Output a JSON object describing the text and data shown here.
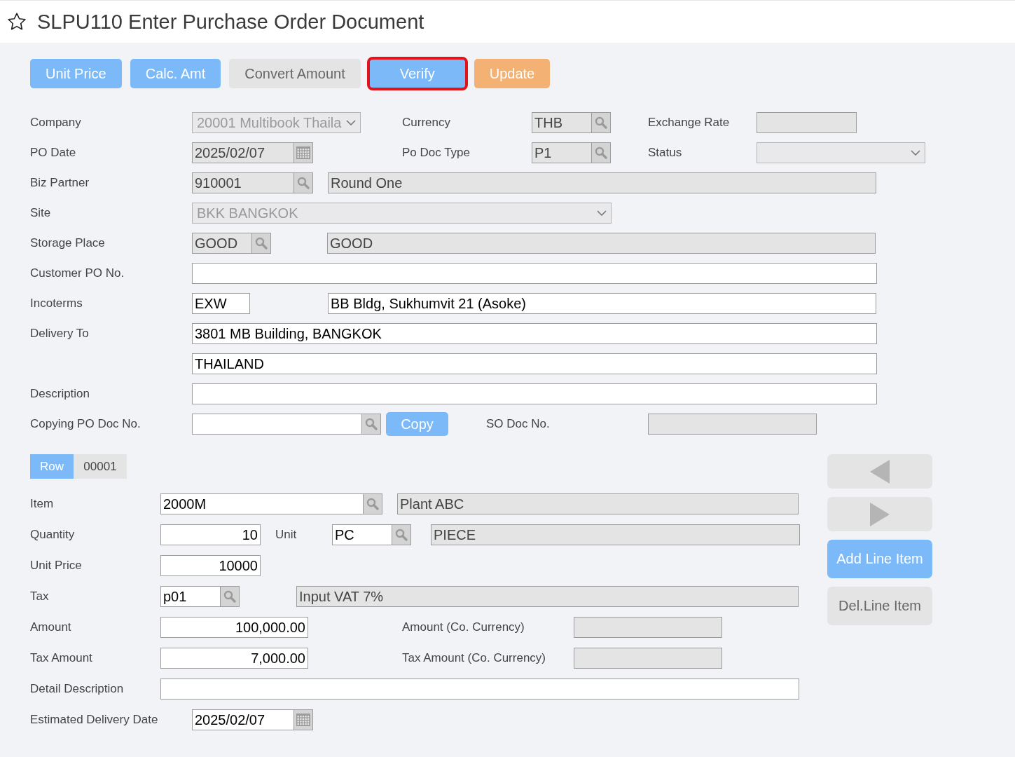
{
  "page": {
    "title": "SLPU110 Enter Purchase Order Document",
    "favorite": false
  },
  "toolbar": [
    {
      "label": "Unit Price",
      "kind": "primary",
      "highlighted": false
    },
    {
      "label": "Calc. Amt",
      "kind": "primary",
      "highlighted": false
    },
    {
      "label": "Convert Amount",
      "kind": "neutral",
      "highlighted": false
    },
    {
      "label": "Verify",
      "kind": "primary",
      "highlighted": true
    },
    {
      "label": "Update",
      "kind": "warning",
      "highlighted": false
    }
  ],
  "header": {
    "company": {
      "label": "Company",
      "value": "20001 Multibook Thaila",
      "editable": false,
      "kind": "select"
    },
    "currency": {
      "label": "Currency",
      "value": "THB",
      "editable": false,
      "kind": "lookup"
    },
    "exchange_rate": {
      "label": "Exchange Rate",
      "editable": false,
      "kind": "text"
    },
    "po_date": {
      "label": "PO Date",
      "value": "2025/02/07",
      "editable": false,
      "kind": "date"
    },
    "po_doc_type": {
      "label": "Po Doc Type",
      "value": "P1",
      "editable": false,
      "kind": "lookup"
    },
    "status": {
      "label": "Status",
      "editable": false,
      "kind": "select"
    },
    "biz_partner": {
      "label": "Biz Partner",
      "value": "910001",
      "editable": false,
      "kind": "lookup"
    },
    "biz_partner_name": {
      "value": "Round One",
      "editable": false,
      "kind": "text"
    },
    "site": {
      "label": "Site",
      "value": "BKK BANGKOK",
      "editable": false,
      "kind": "select"
    },
    "storage_place": {
      "label": "Storage Place",
      "value": "GOOD",
      "editable": false,
      "kind": "lookup"
    },
    "storage_place_name": {
      "value": "GOOD",
      "editable": false,
      "kind": "text"
    },
    "customer_po_no": {
      "label": "Customer PO No.",
      "editable": true,
      "kind": "text"
    },
    "incoterms": {
      "label": "Incoterms",
      "value": "EXW",
      "editable": true,
      "kind": "text"
    },
    "incoterms_name": {
      "value": "BB Bldg, Sukhumvit 21 (Asoke)",
      "editable": true,
      "kind": "text"
    },
    "delivery_to": {
      "label": "Delivery To",
      "value": "3801 MB Building, BANGKOK",
      "editable": true,
      "kind": "text"
    },
    "delivery_to_line_2": {
      "value": "THAILAND",
      "editable": true,
      "kind": "text"
    },
    "description": {
      "label": "Description",
      "editable": true,
      "kind": "text"
    },
    "copying_po_doc_no": {
      "label": "Copying PO Doc No.",
      "editable": true,
      "kind": "lookup"
    },
    "copy_button": "Copy",
    "so_doc_no": {
      "label": "SO Doc No.",
      "editable": false,
      "kind": "text"
    }
  },
  "row_tab": {
    "label": "Row",
    "number": "00001"
  },
  "line": {
    "item": {
      "label": "Item",
      "value": "2000M",
      "editable": true,
      "kind": "lookup"
    },
    "item_name": {
      "value": "Plant ABC",
      "editable": false,
      "kind": "text"
    },
    "quantity": {
      "label": "Quantity",
      "value": "10",
      "editable": true,
      "kind": "number"
    },
    "unit": {
      "label": "Unit",
      "value": "PC",
      "editable": true,
      "kind": "lookup"
    },
    "unit_name": {
      "value": "PIECE",
      "editable": false,
      "kind": "text"
    },
    "unit_price": {
      "label": "Unit Price",
      "value": "10000",
      "editable": true,
      "kind": "number"
    },
    "tax": {
      "label": "Tax",
      "value": "p01",
      "editable": true,
      "kind": "lookup"
    },
    "tax_name": {
      "value": "Input VAT 7%",
      "editable": false,
      "kind": "text"
    },
    "amount": {
      "label": "Amount",
      "value": "100,000.00",
      "editable": true,
      "kind": "number"
    },
    "amount_co_currency": {
      "label": "Amount (Co. Currency)",
      "editable": false,
      "kind": "text"
    },
    "tax_amount": {
      "label": "Tax Amount",
      "value": "7,000.00",
      "editable": true,
      "kind": "number"
    },
    "tax_amount_co_currency": {
      "label": "Tax Amount (Co. Currency)",
      "editable": false,
      "kind": "text"
    },
    "detail_description": {
      "label": "Detail Description",
      "editable": true,
      "kind": "text"
    },
    "estimated_delivery_date": {
      "label": "Estimated Delivery Date",
      "value": "2025/02/07",
      "editable": true,
      "kind": "date"
    }
  },
  "side_buttons": [
    {
      "kind": "previous"
    },
    {
      "kind": "next"
    },
    {
      "kind": "add",
      "label": "Add Line Item"
    },
    {
      "kind": "delete",
      "label": "Del.Line Item"
    }
  ]
}
